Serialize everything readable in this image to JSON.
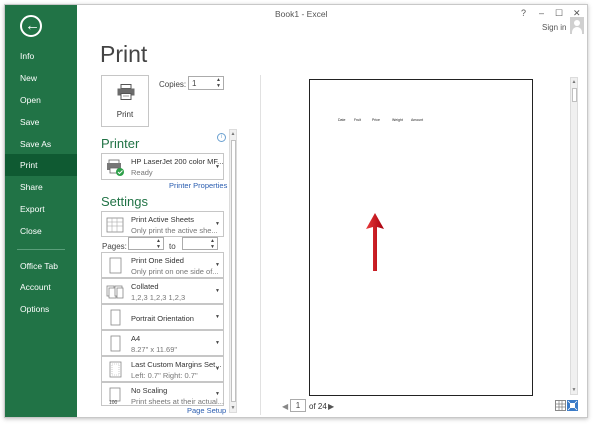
{
  "window": {
    "title": "Book1 - Excel",
    "help": "?",
    "minimize": "–",
    "restore": "☐",
    "close": "✕",
    "sign_in": "Sign in"
  },
  "sidebar": {
    "back_glyph": "←",
    "items": [
      {
        "label": "Info"
      },
      {
        "label": "New"
      },
      {
        "label": "Open"
      },
      {
        "label": "Save"
      },
      {
        "label": "Save As"
      },
      {
        "label": "Print",
        "active": true
      },
      {
        "label": "Share"
      },
      {
        "label": "Export"
      },
      {
        "label": "Close"
      },
      {
        "label": "Office Tab"
      },
      {
        "label": "Account"
      },
      {
        "label": "Options"
      }
    ]
  },
  "print": {
    "title": "Print",
    "button_label": "Print",
    "copies_label": "Copies:",
    "copies_value": "1"
  },
  "printer": {
    "section_title": "Printer",
    "name": "HP LaserJet 200 color MF...",
    "status": "Ready",
    "properties_link": "Printer Properties"
  },
  "settings": {
    "section_title": "Settings",
    "what": {
      "title": "Print Active Sheets",
      "desc": "Only print the active she..."
    },
    "pages_label": "Pages:",
    "to_label": "to",
    "sides": {
      "title": "Print One Sided",
      "desc": "Only print on one side of..."
    },
    "collate": {
      "title": "Collated",
      "desc": "1,2,3    1,2,3    1,2,3"
    },
    "orientation": {
      "title": "Portrait Orientation"
    },
    "paper": {
      "title": "A4",
      "desc": "8.27\" x 11.69\""
    },
    "margins": {
      "title": "Last Custom Margins Set...",
      "desc": "Left:  0.7\"    Right:  0.7\""
    },
    "scaling": {
      "title": "No Scaling",
      "desc": "Print sheets at their actual..."
    },
    "page_setup_link": "Page Setup"
  },
  "preview": {
    "headers": [
      "Date",
      "Fruit",
      "Price",
      "Weight",
      "Amount"
    ],
    "current_page": "1",
    "total_pages": "of 24",
    "prev": "◀",
    "next": "▶"
  },
  "colors": {
    "accent": "#217346",
    "sidebar_active": "#0f5a32",
    "arrow": "#c0101e",
    "link": "#2a5db0"
  }
}
